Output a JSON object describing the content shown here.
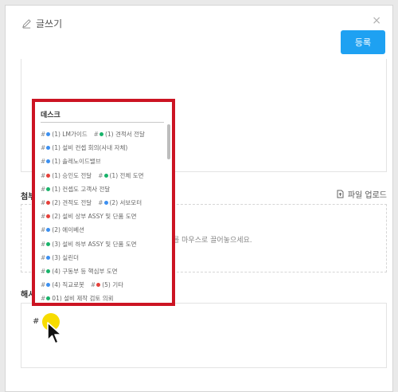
{
  "dialog": {
    "title": "글쓰기",
    "close": "×",
    "register_button": "등록"
  },
  "attachment": {
    "label": "첨부",
    "upload_label": "파일 업로드",
    "drop_hint": "를 마우스로 끌어놓으세요."
  },
  "hashtag": {
    "label": "해시",
    "typed_value": "#"
  },
  "popup": {
    "title": "데스크",
    "rows": [
      [
        {
          "text": "(1) LM가이드",
          "color": "#3b8ff0"
        },
        {
          "text": "(1) 견적서 전달",
          "color": "#18b36a"
        }
      ],
      [
        {
          "text": "(1) 설비 컨셉 회의(사내 자체)",
          "color": "#3b8ff0"
        }
      ],
      [
        {
          "text": "(1) 솔레노이드밸브",
          "color": "#3b8ff0"
        }
      ],
      [
        {
          "text": "(1) 승인도 전달",
          "color": "#e5403a"
        },
        {
          "text": "(1) 전체 도면",
          "color": "#18b36a"
        }
      ],
      [
        {
          "text": "(1) 컨셉도 고객사 전달",
          "color": "#18b36a"
        }
      ],
      [
        {
          "text": "(2) 견적도 전달",
          "color": "#e5403a"
        },
        {
          "text": "(2) 서보모터",
          "color": "#3b8ff0"
        }
      ],
      [
        {
          "text": "(2) 설비 상부 ASSY 및 단품 도면",
          "color": "#e5403a"
        }
      ],
      [
        {
          "text": "(2) 에이베션",
          "color": "#3b8ff0"
        }
      ],
      [
        {
          "text": "(3) 설비 하부 ASSY 및 단품 도면",
          "color": "#18b36a"
        }
      ],
      [
        {
          "text": "(3) 실린더",
          "color": "#3b8ff0"
        }
      ],
      [
        {
          "text": "(4) 구동부 등 핵심부 도면",
          "color": "#18b36a"
        }
      ],
      [
        {
          "text": "(4) 직교로봇",
          "color": "#3b8ff0"
        },
        {
          "text": "(5) 기타",
          "color": "#e5403a"
        }
      ],
      [
        {
          "text": "01) 설비 제작 검토 의뢰",
          "color": "#18b36a"
        }
      ]
    ]
  },
  "colors": {
    "accent": "#1ea1f2",
    "popup_border": "#cc1423",
    "tag_blue": "#3b8ff0",
    "tag_green": "#18b36a",
    "tag_red": "#e5403a",
    "click_highlight": "#f7dc00"
  },
  "icons": [
    "pencil-icon",
    "close-icon",
    "file-upload-icon",
    "mouse-cursor-icon"
  ]
}
